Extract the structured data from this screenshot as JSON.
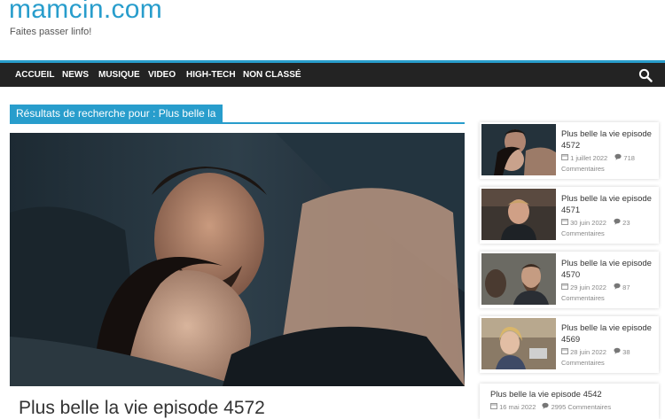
{
  "site": {
    "title": "mamcin.com",
    "tagline": "Faites passer linfo!"
  },
  "nav": {
    "items": [
      {
        "label": "ACCUEIL"
      },
      {
        "label": "NEWS"
      },
      {
        "label": "MUSIQUE"
      },
      {
        "label": "VIDEO"
      },
      {
        "label": "HIGH-TECH"
      },
      {
        "label": "NON CLASSÉ"
      }
    ],
    "search_icon": "search-icon"
  },
  "main": {
    "results_heading": "Résultats de recherche pour : Plus belle la",
    "featured_post": {
      "title": "Plus belle la vie episode 4572"
    }
  },
  "sidebar": {
    "posts": [
      {
        "title": "Plus belle la vie episode 4572",
        "date": "1 juillet 2022",
        "comments": "718",
        "comments_label": "Commentaires"
      },
      {
        "title": "Plus belle la vie episode 4571",
        "date": "30 juin 2022",
        "comments": "23",
        "comments_label": "Commentaires"
      },
      {
        "title": "Plus belle la vie episode 4570",
        "date": "29 juin 2022",
        "comments": "87",
        "comments_label": "Commentaires"
      },
      {
        "title": "Plus belle la vie episode 4569",
        "date": "28 juin 2022",
        "comments": "38",
        "comments_label": "Commentaires"
      }
    ],
    "last_post": {
      "title": "Plus belle la vie episode 4542",
      "date": "16 mai 2022",
      "comments": "2995 Commentaires"
    }
  },
  "colors": {
    "accent": "#289dcc",
    "nav_bg": "#232323"
  }
}
